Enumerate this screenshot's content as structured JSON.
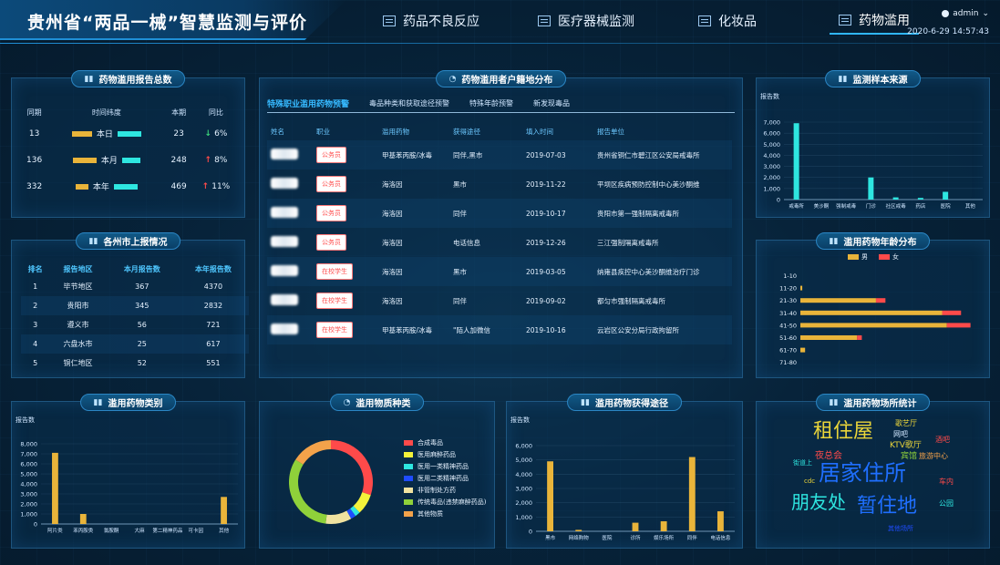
{
  "header": {
    "title": "贵州省“两品一械”智慧监测与评价",
    "nav": [
      {
        "label": "药品不良反应",
        "active": false
      },
      {
        "label": "医疗器械监测",
        "active": false
      },
      {
        "label": "化妆品",
        "active": false
      },
      {
        "label": "药物滥用",
        "active": true
      }
    ],
    "user": "admin",
    "datetime": "2020-6-29 14:57:43"
  },
  "report_totals": {
    "title": "药物滥用报告总数",
    "columns": [
      "同期",
      "时间纬度",
      "本期",
      "同比"
    ],
    "rows": [
      {
        "prev": "13",
        "dim": "本日",
        "cur": "23",
        "dir": "down",
        "pct": "6%",
        "ybar": 22,
        "cbar": 26
      },
      {
        "prev": "136",
        "dim": "本月",
        "cur": "248",
        "dir": "up",
        "pct": "8%",
        "ybar": 26,
        "cbar": 20
      },
      {
        "prev": "332",
        "dim": "本年",
        "cur": "469",
        "dir": "up",
        "pct": "11%",
        "ybar": 14,
        "cbar": 26
      }
    ]
  },
  "city_reports": {
    "title": "各州市上报情况",
    "columns": [
      "排名",
      "报告地区",
      "本月报告数",
      "本年报告数"
    ],
    "rows": [
      [
        "1",
        "毕节地区",
        "367",
        "4370"
      ],
      [
        "2",
        "贵阳市",
        "345",
        "2832"
      ],
      [
        "3",
        "遵义市",
        "56",
        "721"
      ],
      [
        "4",
        "六盘水市",
        "25",
        "617"
      ],
      [
        "5",
        "铜仁地区",
        "52",
        "551"
      ]
    ]
  },
  "abuser_registry": {
    "title": "药物滥用者户籍地分布",
    "tabs": [
      "特殊职业滥用药物预警",
      "毒品种类和获取途径预警",
      "特殊年龄预警",
      "新发现毒品"
    ],
    "columns": [
      "姓名",
      "职业",
      "滥用药物",
      "获得途径",
      "填入时间",
      "报告单位"
    ],
    "rows": [
      {
        "job": "公务员",
        "drug": "甲基苯丙胺/冰毒",
        "route": "同伴,黑市",
        "date": "2019-07-03",
        "unit": "贵州省铜仁市碧江区公安局戒毒所"
      },
      {
        "job": "公务员",
        "drug": "海洛因",
        "route": "黑市",
        "date": "2019-11-22",
        "unit": "平坝区疾病预防控制中心美沙酮维"
      },
      {
        "job": "公务员",
        "drug": "海洛因",
        "route": "同伴",
        "date": "2019-10-17",
        "unit": "贵阳市第一强制隔离戒毒所"
      },
      {
        "job": "公务员",
        "drug": "海洛因",
        "route": "电话信息",
        "date": "2019-12-26",
        "unit": "三江强制隔离戒毒所"
      },
      {
        "job": "在校学生",
        "drug": "海洛因",
        "route": "黑市",
        "date": "2019-03-05",
        "unit": "纳雍县疾控中心美沙酮维治疗门诊"
      },
      {
        "job": "在校学生",
        "drug": "海洛因",
        "route": "同伴",
        "date": "2019-09-02",
        "unit": "都匀市强制隔离戒毒所"
      },
      {
        "job": "在校学生",
        "drug": "甲基苯丙胺/冰毒",
        "route": "\"陌人加微信",
        "date": "2019-10-16",
        "unit": "云岩区公安分局行政拘留所"
      }
    ]
  },
  "sample_source": {
    "title": "监测样本来源",
    "chart_data": {
      "type": "bar",
      "ylabel": "报告数",
      "ylim": [
        0,
        7000
      ],
      "yticks": [
        "0",
        "1,000",
        "2,000",
        "3,000",
        "4,000",
        "5,000",
        "6,000",
        "7,000"
      ],
      "categories": [
        "戒毒所",
        "美沙酮",
        "强制戒毒",
        "门诊",
        "社区戒毒",
        "药店",
        "医院",
        "其他"
      ],
      "values": [
        6900,
        0,
        0,
        2000,
        200,
        150,
        700,
        0
      ],
      "color": "#2ee6e0"
    }
  },
  "age_distribution": {
    "title": "滥用药物年龄分布",
    "chart_data": {
      "type": "bar",
      "orientation": "horizontal",
      "legend": [
        {
          "name": "男",
          "color": "#e9b43a"
        },
        {
          "name": "女",
          "color": "#ff4a4a"
        }
      ],
      "categories": [
        "1-10",
        "11-20",
        "21-30",
        "31-40",
        "41-50",
        "51-60",
        "61-70",
        "71-80"
      ],
      "series": [
        {
          "name": "男",
          "values": [
            0,
            2,
            80,
            150,
            155,
            60,
            5,
            0
          ]
        },
        {
          "name": "女",
          "values": [
            0,
            0,
            10,
            20,
            25,
            5,
            0,
            0
          ]
        }
      ],
      "xlim": [
        0,
        190
      ]
    }
  },
  "drug_category": {
    "title": "滥用药物类别",
    "chart_data": {
      "type": "bar",
      "ylabel": "报告数",
      "ylim": [
        0,
        8000
      ],
      "yticks": [
        "0",
        "1,000",
        "2,000",
        "3,000",
        "4,000",
        "5,000",
        "6,000",
        "7,000",
        "8,000"
      ],
      "categories": [
        "阿片类",
        "苯丙胺类",
        "氯胺酮",
        "大麻",
        "第二精神药品",
        "可卡因",
        "其他"
      ],
      "values": [
        7100,
        1000,
        0,
        0,
        0,
        0,
        2700
      ],
      "color": "#e9b43a"
    }
  },
  "substance_type": {
    "title": "滥用物质种类",
    "chart_data": {
      "type": "pie",
      "donut": true,
      "slices": [
        {
          "name": "合成毒品",
          "value": 30,
          "color": "#ff4a4a"
        },
        {
          "name": "医用麻醉药品",
          "value": 8,
          "color": "#f4f23a"
        },
        {
          "name": "医用一类精神药品",
          "value": 2,
          "color": "#2ee6e0"
        },
        {
          "name": "医用二类精神药品",
          "value": 2,
          "color": "#1f4cff"
        },
        {
          "name": "非管制处方药",
          "value": 10,
          "color": "#f0e2a0"
        },
        {
          "name": "传统毒品(违禁麻醉药品)",
          "value": 32,
          "color": "#8fd13a"
        },
        {
          "name": "其他物质",
          "value": 16,
          "color": "#f3a24a"
        }
      ]
    }
  },
  "acquisition_route": {
    "title": "滥用药物获得途径",
    "chart_data": {
      "type": "bar",
      "ylabel": "报告数",
      "ylim": [
        0,
        6000
      ],
      "yticks": [
        "0",
        "1,000",
        "2,000",
        "3,000",
        "4,000",
        "5,000",
        "6,000"
      ],
      "categories": [
        "黑市",
        "网络购物",
        "医院",
        "诊所",
        "娱乐场所",
        "同伴",
        "电话信息"
      ],
      "values": [
        4900,
        100,
        0,
        600,
        700,
        5200,
        1400
      ],
      "color": "#e9b43a"
    }
  },
  "venue_stats": {
    "title": "滥用药物场所统计",
    "words": [
      {
        "text": "租住屋",
        "color": "#e9d43a",
        "size": 22,
        "left": 62,
        "top": 22
      },
      {
        "text": "居家住所",
        "color": "#1f6fff",
        "size": 24,
        "left": 68,
        "top": 66
      },
      {
        "text": "朋友处",
        "color": "#2ee6e0",
        "size": 20,
        "left": 38,
        "top": 100
      },
      {
        "text": "暂住地",
        "color": "#1f6fff",
        "size": 22,
        "left": 110,
        "top": 104
      },
      {
        "text": "夜总会",
        "color": "#ff4a4a",
        "size": 10,
        "left": 64,
        "top": 55
      },
      {
        "text": "歌艺厅",
        "color": "#e9d43a",
        "size": 8,
        "left": 152,
        "top": 20
      },
      {
        "text": "网吧",
        "color": "#cfe6ff",
        "size": 8,
        "left": 150,
        "top": 32
      },
      {
        "text": "KTV歌厅",
        "color": "#e9d43a",
        "size": 9,
        "left": 146,
        "top": 44
      },
      {
        "text": "宾馆",
        "color": "#8fd13a",
        "size": 9,
        "left": 158,
        "top": 56
      },
      {
        "text": "旅游中心",
        "color": "#f3a24a",
        "size": 8,
        "left": 178,
        "top": 56
      },
      {
        "text": "酒吧",
        "color": "#ff4a4a",
        "size": 8,
        "left": 196,
        "top": 38
      },
      {
        "text": "车内",
        "color": "#ff4a4a",
        "size": 8,
        "left": 200,
        "top": 84
      },
      {
        "text": "公园",
        "color": "#2ee6e0",
        "size": 8,
        "left": 200,
        "top": 108
      },
      {
        "text": "街道上",
        "color": "#2ee6e0",
        "size": 7,
        "left": 40,
        "top": 64
      },
      {
        "text": "cdc",
        "color": "#e9d43a",
        "size": 7,
        "left": 52,
        "top": 84
      },
      {
        "text": "其他场所",
        "color": "#1f4cff",
        "size": 7,
        "left": 144,
        "top": 136
      }
    ]
  }
}
